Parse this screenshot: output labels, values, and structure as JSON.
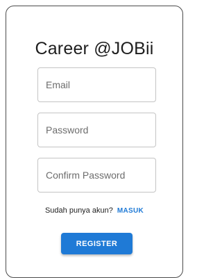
{
  "title": "Career @JOBii",
  "form": {
    "email": {
      "value": "",
      "placeholder": "Email"
    },
    "password": {
      "value": "",
      "placeholder": "Password"
    },
    "confirm_password": {
      "value": "",
      "placeholder": "Confirm Password"
    }
  },
  "login_prompt": {
    "text": "Sudah punya akun?",
    "link_label": "MASUK"
  },
  "register_button": {
    "label": "REGISTER"
  },
  "colors": {
    "accent": "#1f7ad6",
    "text": "#1e1e1e",
    "field_border": "#c4c4c4",
    "card_border": "#4a4a4a"
  }
}
